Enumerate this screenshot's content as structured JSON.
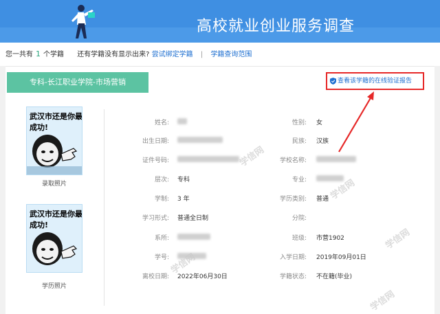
{
  "header": {
    "title": "高校就业创业服务调查"
  },
  "infobar": {
    "prefix": "您一共有",
    "count": "1",
    "suffix": "个学籍",
    "question": "还有学籍没有显示出来?",
    "link_bind": "尝试绑定学籍",
    "separator": "|",
    "link_scope": "学籍查询范围"
  },
  "record": {
    "tab_label": "专科-长江职业学院-市场营销",
    "verify_label": "查看该学籍的在线验证报告",
    "photos": [
      {
        "meme_text": "武汉市还是你最成功!",
        "caption": "录取照片"
      },
      {
        "meme_text": "武汉市还是你最成功!",
        "caption": "学历照片"
      }
    ],
    "left_fields": [
      {
        "label": "姓名:",
        "value": ""
      },
      {
        "label": "出生日期:",
        "value": ""
      },
      {
        "label": "证件号码:",
        "value": ""
      },
      {
        "label": "层次:",
        "value": "专科"
      },
      {
        "label": "学制:",
        "value": "3 年"
      },
      {
        "label": "学习形式:",
        "value": "普通全日制"
      },
      {
        "label": "系所:",
        "value": ""
      },
      {
        "label": "学号:",
        "value": ""
      },
      {
        "label": "离校日期:",
        "value": "2022年06月30日"
      }
    ],
    "right_fields": [
      {
        "label": "性别:",
        "value": "女"
      },
      {
        "label": "民族:",
        "value": "汉族"
      },
      {
        "label": "学校名称:",
        "value": ""
      },
      {
        "label": "专业:",
        "value": ""
      },
      {
        "label": "学历类别:",
        "value": "普通"
      },
      {
        "label": "分院:",
        "value": ""
      },
      {
        "label": "班级:",
        "value": "市营1902"
      },
      {
        "label": "入学日期:",
        "value": "2019年09月01日"
      },
      {
        "label": "学籍状态:",
        "value": "不在籍(毕业)"
      }
    ]
  },
  "colors": {
    "banner": "#3f8fe2",
    "tab": "#5cc3a2",
    "highlight": "#e62828",
    "link": "#1e6fd0"
  },
  "icons": [
    "runner-figure",
    "shield-check-icon",
    "annotation-arrow"
  ]
}
